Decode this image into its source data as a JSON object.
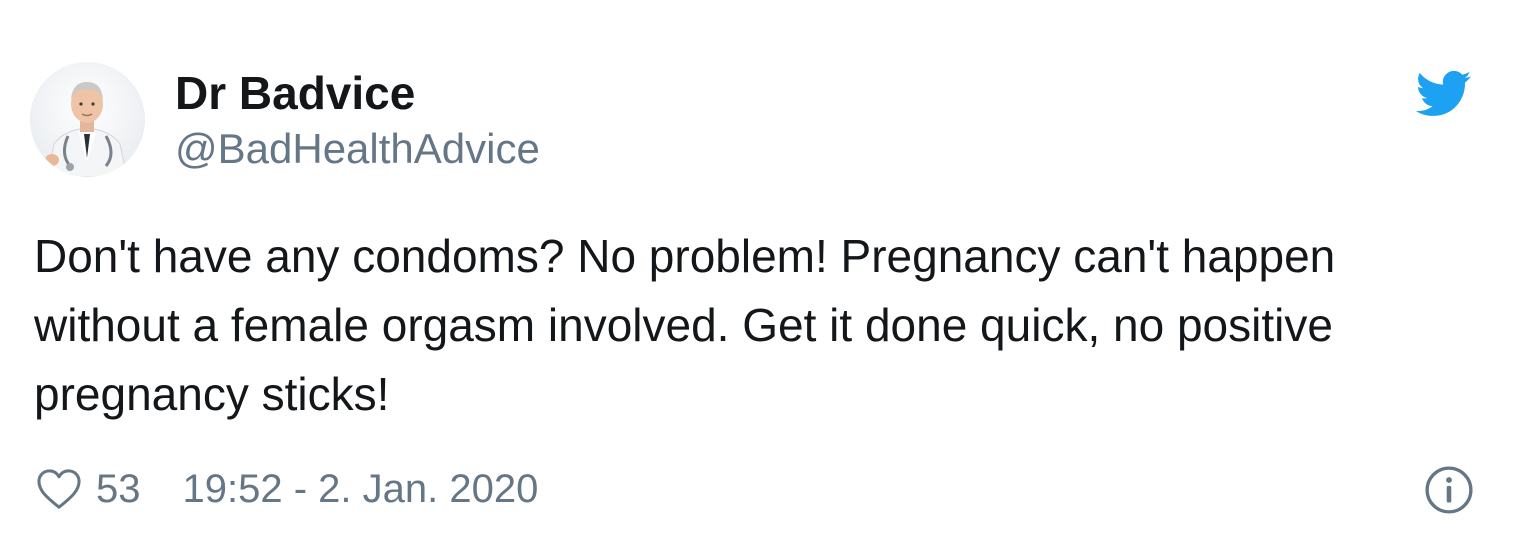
{
  "author": {
    "display_name": "Dr Badvice",
    "handle": "@BadHealthAdvice",
    "avatar_icon": "doctor-avatar"
  },
  "brand_icon": "twitter-bird-icon",
  "tweet": {
    "text": "Don't have any condoms? No problem! Pregnancy can't happen\nwithout a female orgasm involved. Get it done quick, no positive\npregnancy sticks!"
  },
  "footer": {
    "like_icon": "heart-icon",
    "like_count": "53",
    "timestamp": "19:52 - 2. Jan. 2020",
    "info_icon": "info-icon"
  },
  "colors": {
    "twitter_blue": "#1da1f2",
    "secondary_text": "#657786",
    "primary_text": "#14171a"
  }
}
